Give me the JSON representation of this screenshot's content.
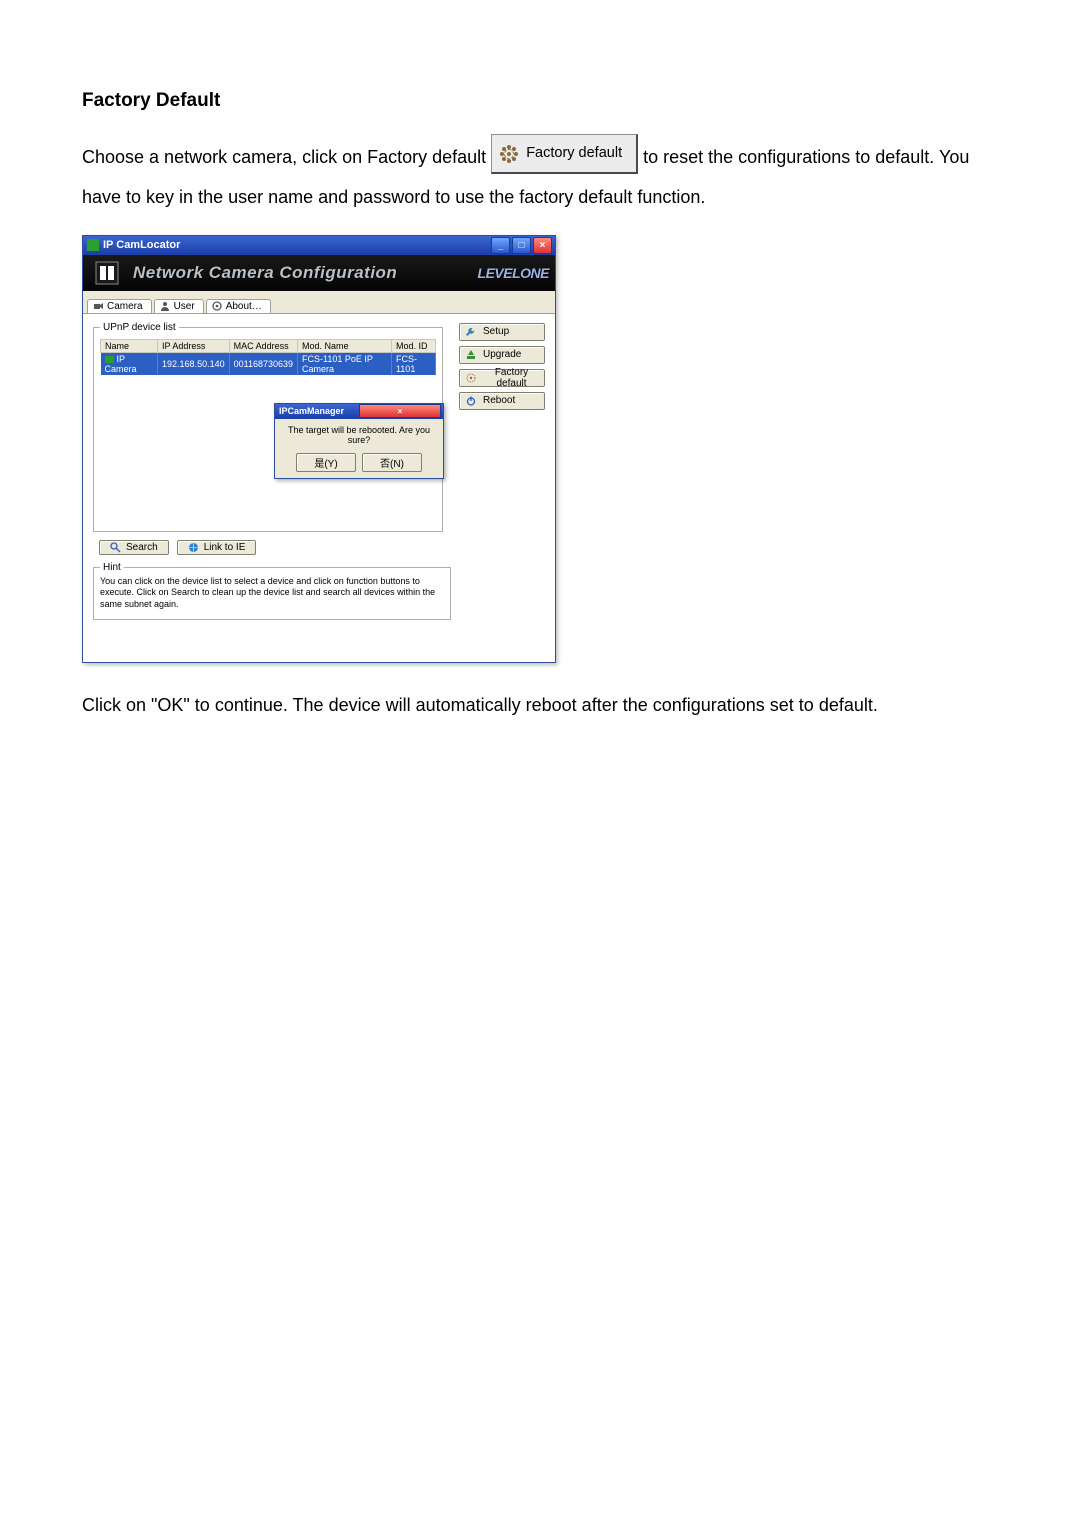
{
  "heading": "Factory Default",
  "para1_before": "Choose a network camera, click on Factory default ",
  "inline_button_label": "Factory default",
  "para1_after": " to reset the configurations to default. You have to key in the user name and password to use the factory default function.",
  "para2": "Click on \"OK\" to continue. The device will automatically reboot after the configurations set to default.",
  "window": {
    "title": "IP CamLocator",
    "banner_title": "Network Camera Configuration",
    "brand_right": "LEVELONE",
    "tabs": {
      "camera": "Camera",
      "user": "User",
      "about": "About…"
    },
    "upnp_legend": "UPnP device list",
    "headers": {
      "name": "Name",
      "ip": "IP Address",
      "mac": "MAC Address",
      "modname": "Mod. Name",
      "modid": "Mod. ID"
    },
    "row": {
      "name": "IP Camera",
      "ip": "192.168.50.140",
      "mac": "001168730639",
      "modname": "FCS-1101 PoE IP Camera",
      "modid": "FCS-1101"
    },
    "dialog": {
      "title": "IPCamManager",
      "message": "The target will be rebooted. Are you sure?",
      "ok": "是(Y)",
      "cancel": "否(N)"
    },
    "search": "Search",
    "linkie": "Link to IE",
    "hint_legend": "Hint",
    "hint_text": "You can click on the device list to select a device and click on function buttons to execute. Click on Search to clean up the device list and search all devices within the same subnet again.",
    "side": {
      "setup": "Setup",
      "upgrade": "Upgrade",
      "factory": "Factory default",
      "reboot": "Reboot"
    }
  }
}
